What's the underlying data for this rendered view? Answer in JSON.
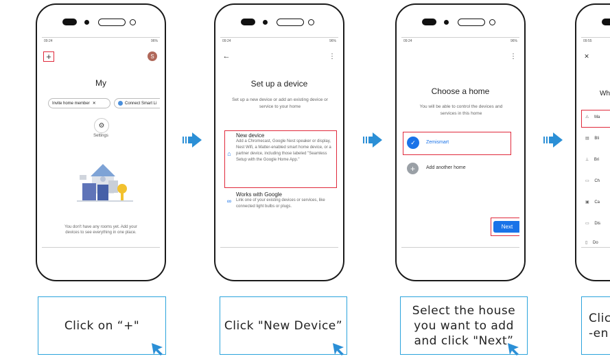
{
  "status_bar": {
    "p1_time": "09:24",
    "p2_time": "09:24",
    "p3_time": "09:24",
    "p4_time": "09:55",
    "right": "96%"
  },
  "phone1": {
    "title": "My",
    "chip_invite": "Invite home member",
    "chip_connect": "Connect Smart Li",
    "settings_label": "Settings",
    "avatar_letter": "S",
    "empty_text": "You don't have any rooms yet. Add your devices to see everything in one place."
  },
  "phone2": {
    "title": "Set up a device",
    "subtitle": "Set up a new device or add an existing device or service to your home",
    "option1_title": "New device",
    "option1_desc": "Add a Chromecast, Google Nest speaker or display, Nest Wifi, a Matter-enabled smart home device, or a partner device, including those labeled \"Seamless Setup with the Google Home App.\"",
    "option2_title": "Works with Google",
    "option2_desc": "Link one of your existing devices or services, like connected light bulbs or plugs."
  },
  "phone3": {
    "title": "Choose a home",
    "subtitle": "You will be able to control the devices and services in this home",
    "home_selected": "Zemismart",
    "home_add": "Add another home",
    "next_button": "Next"
  },
  "phone4": {
    "title_partial": "Wha",
    "items": [
      "Ma",
      "Bli",
      "Bri",
      "Ch",
      "Ca",
      "Dis",
      "Do"
    ]
  },
  "captions": {
    "c1": "Click on  “+\"",
    "c2": "Click \"New Device”",
    "c3": "Select the house you want to add and click \"Next”",
    "c4_line1": "Clic",
    "c4_line2": "-en"
  },
  "colors": {
    "accent_blue": "#2b8fd6",
    "google_blue": "#1a73e8",
    "highlight_red": "#e0283a",
    "caption_border": "#2aa3dc"
  },
  "icons": [
    "plus-icon",
    "back-arrow-icon",
    "more-vert-icon",
    "close-icon",
    "gear-icon",
    "home-icon",
    "link-icon",
    "check-icon",
    "add-circle-icon",
    "right-arrow-icon",
    "cursor-icon"
  ]
}
